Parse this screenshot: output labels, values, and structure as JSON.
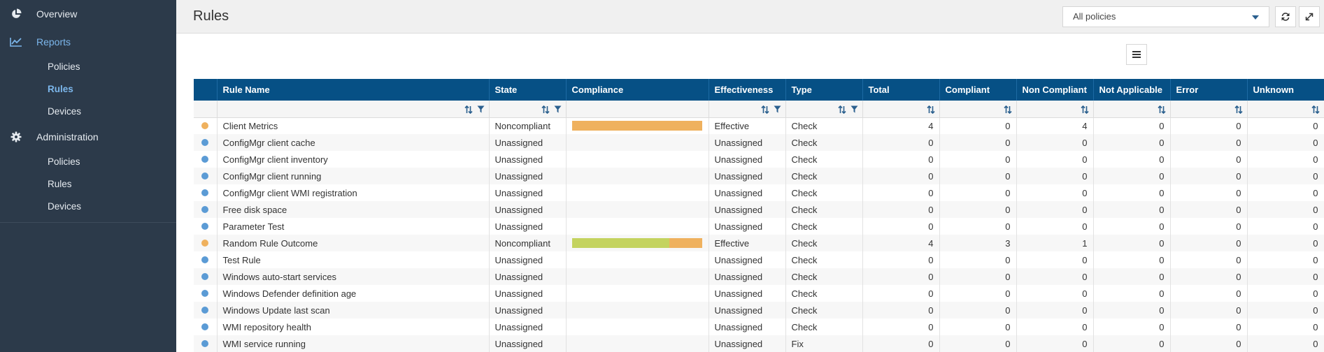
{
  "sidebar": {
    "overview": "Overview",
    "reports": {
      "label": "Reports",
      "items": [
        "Policies",
        "Rules",
        "Devices"
      ]
    },
    "administration": {
      "label": "Administration",
      "items": [
        "Policies",
        "Rules",
        "Devices"
      ]
    }
  },
  "header": {
    "title": "Rules",
    "policy_select": "All policies"
  },
  "colors": {
    "accent": "#065085",
    "noncompliant": "#efb15e",
    "compliant": "#c4d35f",
    "unassigned": "#5b9bd5",
    "sidebar": "#2c3a4a",
    "active_nav": "#7cb7ec"
  },
  "table": {
    "columns": [
      "Rule Name",
      "State",
      "Compliance",
      "Effectiveness",
      "Type",
      "Total",
      "Compliant",
      "Non Compliant",
      "Not Applicable",
      "Error",
      "Unknown"
    ],
    "rows": [
      {
        "status": "noncompliant",
        "name": "Client Metrics",
        "state": "Noncompliant",
        "compliance": {
          "compliant": 0,
          "noncompliant": 4
        },
        "effectiveness": "Effective",
        "type": "Check",
        "total": "4",
        "compliant": "0",
        "non_compliant": "4",
        "not_applicable": "0",
        "error": "0",
        "unknown": "0"
      },
      {
        "status": "unassigned",
        "name": "ConfigMgr client cache",
        "state": "Unassigned",
        "compliance": null,
        "effectiveness": "Unassigned",
        "type": "Check",
        "total": "0",
        "compliant": "0",
        "non_compliant": "0",
        "not_applicable": "0",
        "error": "0",
        "unknown": "0"
      },
      {
        "status": "unassigned",
        "name": "ConfigMgr client inventory",
        "state": "Unassigned",
        "compliance": null,
        "effectiveness": "Unassigned",
        "type": "Check",
        "total": "0",
        "compliant": "0",
        "non_compliant": "0",
        "not_applicable": "0",
        "error": "0",
        "unknown": "0"
      },
      {
        "status": "unassigned",
        "name": "ConfigMgr client running",
        "state": "Unassigned",
        "compliance": null,
        "effectiveness": "Unassigned",
        "type": "Check",
        "total": "0",
        "compliant": "0",
        "non_compliant": "0",
        "not_applicable": "0",
        "error": "0",
        "unknown": "0"
      },
      {
        "status": "unassigned",
        "name": "ConfigMgr client WMI registration",
        "state": "Unassigned",
        "compliance": null,
        "effectiveness": "Unassigned",
        "type": "Check",
        "total": "0",
        "compliant": "0",
        "non_compliant": "0",
        "not_applicable": "0",
        "error": "0",
        "unknown": "0"
      },
      {
        "status": "unassigned",
        "name": "Free disk space",
        "state": "Unassigned",
        "compliance": null,
        "effectiveness": "Unassigned",
        "type": "Check",
        "total": "0",
        "compliant": "0",
        "non_compliant": "0",
        "not_applicable": "0",
        "error": "0",
        "unknown": "0"
      },
      {
        "status": "unassigned",
        "name": "Parameter Test",
        "state": "Unassigned",
        "compliance": null,
        "effectiveness": "Unassigned",
        "type": "Check",
        "total": "0",
        "compliant": "0",
        "non_compliant": "0",
        "not_applicable": "0",
        "error": "0",
        "unknown": "0"
      },
      {
        "status": "noncompliant",
        "name": "Random Rule Outcome",
        "state": "Noncompliant",
        "compliance": {
          "compliant": 3,
          "noncompliant": 1
        },
        "effectiveness": "Effective",
        "type": "Check",
        "total": "4",
        "compliant": "3",
        "non_compliant": "1",
        "not_applicable": "0",
        "error": "0",
        "unknown": "0"
      },
      {
        "status": "unassigned",
        "name": "Test Rule",
        "state": "Unassigned",
        "compliance": null,
        "effectiveness": "Unassigned",
        "type": "Check",
        "total": "0",
        "compliant": "0",
        "non_compliant": "0",
        "not_applicable": "0",
        "error": "0",
        "unknown": "0"
      },
      {
        "status": "unassigned",
        "name": "Windows auto-start services",
        "state": "Unassigned",
        "compliance": null,
        "effectiveness": "Unassigned",
        "type": "Check",
        "total": "0",
        "compliant": "0",
        "non_compliant": "0",
        "not_applicable": "0",
        "error": "0",
        "unknown": "0"
      },
      {
        "status": "unassigned",
        "name": "Windows Defender definition age",
        "state": "Unassigned",
        "compliance": null,
        "effectiveness": "Unassigned",
        "type": "Check",
        "total": "0",
        "compliant": "0",
        "non_compliant": "0",
        "not_applicable": "0",
        "error": "0",
        "unknown": "0"
      },
      {
        "status": "unassigned",
        "name": "Windows Update last scan",
        "state": "Unassigned",
        "compliance": null,
        "effectiveness": "Unassigned",
        "type": "Check",
        "total": "0",
        "compliant": "0",
        "non_compliant": "0",
        "not_applicable": "0",
        "error": "0",
        "unknown": "0"
      },
      {
        "status": "unassigned",
        "name": "WMI repository health",
        "state": "Unassigned",
        "compliance": null,
        "effectiveness": "Unassigned",
        "type": "Check",
        "total": "0",
        "compliant": "0",
        "non_compliant": "0",
        "not_applicable": "0",
        "error": "0",
        "unknown": "0"
      },
      {
        "status": "unassigned",
        "name": "WMI service running",
        "state": "Unassigned",
        "compliance": null,
        "effectiveness": "Unassigned",
        "type": "Fix",
        "total": "0",
        "compliant": "0",
        "non_compliant": "0",
        "not_applicable": "0",
        "error": "0",
        "unknown": "0"
      }
    ]
  }
}
